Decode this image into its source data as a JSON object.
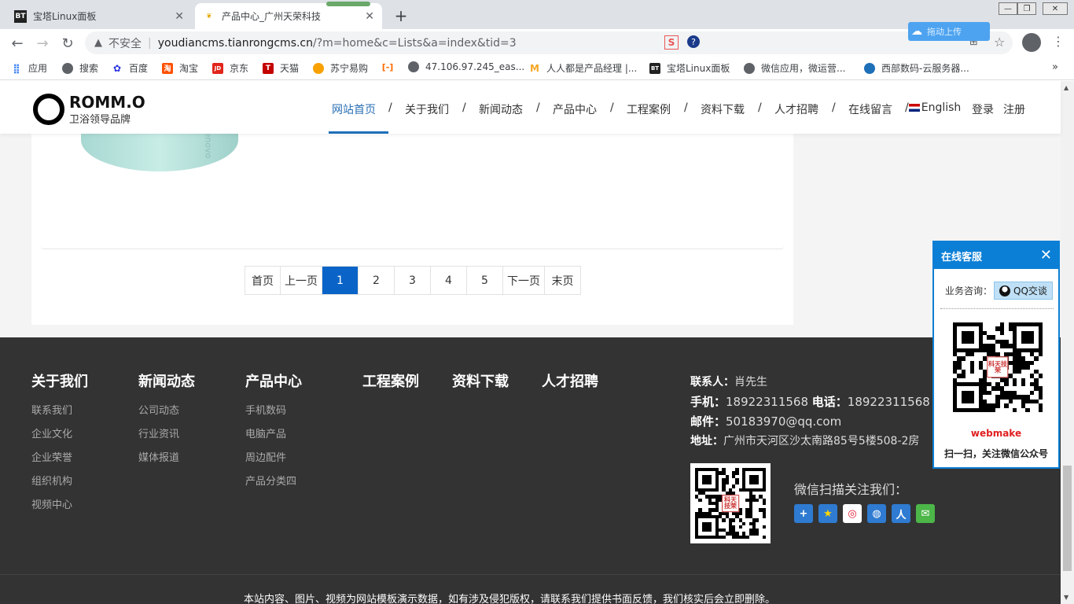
{
  "browser": {
    "tabs": [
      {
        "title": "宝塔Linux面板",
        "icon": "BT"
      },
      {
        "title": "产品中心_广州天荣科技",
        "icon": "leaf"
      }
    ],
    "new_tab": "+",
    "insecure_label": "不安全",
    "url_host": "youdiancms.tianrongcms.cn",
    "url_path": "/?m=home&c=Lists&a=index&tid=3",
    "float_label": "拖动上传",
    "bookmarks": [
      {
        "label": "应用",
        "icon": "apps-icon",
        "color": "#4285f4"
      },
      {
        "label": "搜索",
        "icon": "globe-icon",
        "color": "#5f6368"
      },
      {
        "label": "百度",
        "icon": "paw-icon",
        "color": "#2932e1"
      },
      {
        "label": "淘宝",
        "icon": "taobao-icon",
        "color": "#ff5000"
      },
      {
        "label": "京东",
        "icon": "JD",
        "color": "#e1251b"
      },
      {
        "label": "天猫",
        "icon": "T",
        "color": "#c40000"
      },
      {
        "label": "苏宁易购",
        "icon": "suning-icon",
        "color": "#f8a100"
      },
      {
        "label": "",
        "icon": "bracket-icon",
        "color": "#ff6a00"
      },
      {
        "label": "47.106.97.245_eas...",
        "icon": "globe-icon",
        "color": "#5f6368"
      },
      {
        "label": "人人都是产品经理 |...",
        "icon": "woshipm-icon",
        "color": "#f5a623"
      },
      {
        "label": "宝塔Linux面板",
        "icon": "BT",
        "color": "#222"
      },
      {
        "label": "微信应用，微运营...",
        "icon": "globe-icon",
        "color": "#5f6368"
      },
      {
        "label": "西部数码-云服务器...",
        "icon": "west-icon",
        "color": "#1d6fb8"
      }
    ]
  },
  "site": {
    "logo_name": "ROMM.O",
    "logo_tagline": "卫浴领导品牌",
    "nav": [
      "网站首页",
      "关于我们",
      "新闻动态",
      "产品中心",
      "工程案例",
      "资料下载",
      "人才招聘",
      "在线留言"
    ],
    "nav_english": "English",
    "login": "登录",
    "register": "注册",
    "product_mark": "Lenovo"
  },
  "pagination": {
    "first": "首页",
    "prev": "上一页",
    "pages": [
      "1",
      "2",
      "3",
      "4",
      "5"
    ],
    "current": "1",
    "next": "下一页",
    "last": "末页"
  },
  "footer": {
    "columns": [
      {
        "title": "关于我们",
        "links": [
          "联系我们",
          "企业文化",
          "企业荣誉",
          "组织机构",
          "视频中心"
        ]
      },
      {
        "title": "新闻动态",
        "links": [
          "公司动态",
          "行业资讯",
          "媒体报道"
        ]
      },
      {
        "title": "产品中心",
        "links": [
          "手机数码",
          "电脑产品",
          "周边配件",
          "产品分类四"
        ]
      },
      {
        "title": "工程案例",
        "links": []
      },
      {
        "title": "资料下载",
        "links": []
      },
      {
        "title": "人才招聘",
        "links": []
      }
    ],
    "contact_person_label": "联系人：",
    "contact_person": "肖先生",
    "mobile_label": "手机：",
    "mobile": "18922311568",
    "phone_label": "电话：",
    "phone": "18922311568",
    "email_label": "邮件：",
    "email": "50183970@qq.com",
    "address_label": "地址：",
    "address": "广州市天河区沙太南路85号5楼508-2房",
    "follow_text": "微信扫描关注我们：",
    "qr_badge": "科天技荣",
    "copyright": "本站内容、图片、视频为网站模板演示数据，如有涉及侵犯版权，请联系我们提供书面反馈，我们核实后会立即删除。"
  },
  "service_widget": {
    "title": "在线客服",
    "consult_label": "业务咨询：",
    "qq_button": "QQ交谈",
    "brand": "webmake",
    "subtitle": "扫一扫，关注微信公众号",
    "qr_badge": "科天技荣"
  },
  "colors": {
    "accent": "#0a64c8",
    "nav_active": "#2a6fb5",
    "footer_bg": "#333333",
    "service_blue": "#0b7fd6"
  }
}
